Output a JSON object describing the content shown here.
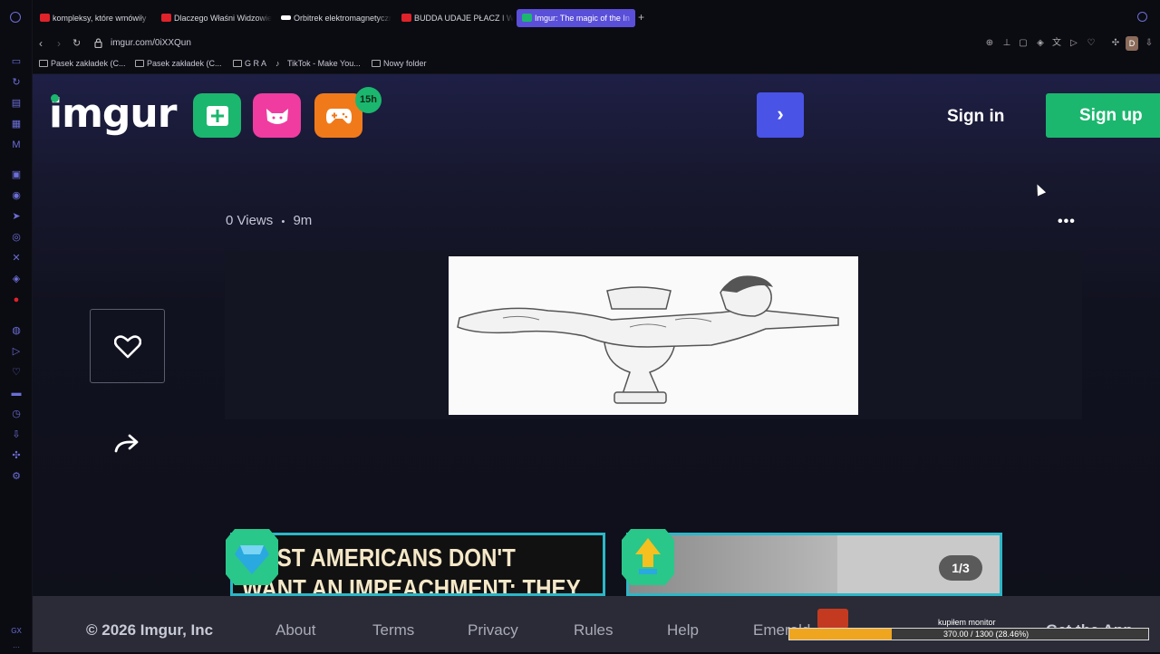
{
  "browser": {
    "tabs": [
      {
        "title": "kompleksy, które wmówiły",
        "favicon_color": "#e0222a"
      },
      {
        "title": "Dlaczego Właśni Widzowie",
        "favicon_color": "#e0222a"
      },
      {
        "title": "Orbitrek elektromagnetyczny",
        "favicon_color": "#ffffff"
      },
      {
        "title": "BUDDA UDAJE PŁACZ I W",
        "favicon_color": "#e0222a"
      },
      {
        "title": "Imgur: The magic of the In",
        "favicon_color": "#1bb76e",
        "active": true
      }
    ],
    "url": "imgur.com/0iXXQun",
    "profile_initial": "D",
    "bookmarks": [
      {
        "label": "Pasek zakładek (C..."
      },
      {
        "label": "Pasek zakładek (C..."
      },
      {
        "label": "G R A"
      },
      {
        "label": "TikTok - Make You..."
      },
      {
        "label": "Nowy folder"
      }
    ]
  },
  "imgur": {
    "logo": "imgur",
    "badge": "15h",
    "sign_in": "Sign in",
    "sign_up": "Sign up",
    "meta": {
      "views": "0 Views",
      "separator": "•",
      "age": "9m"
    },
    "card1_text_line1": "MOST AMERICANS DON'T",
    "card1_text_line2": "WANT AN IMPEACHMENT: THEY",
    "card2_counter": "1/3",
    "footer": {
      "copyright": "© 2026 Imgur, Inc",
      "about": "About",
      "terms": "Terms",
      "privacy": "Privacy",
      "rules": "Rules",
      "help": "Help",
      "emerald": "Emerald",
      "get_app": "Get the App"
    }
  },
  "stream_widget": {
    "label": "kupiłem monitor",
    "progress_text": "370.00 / 1300 (28.46%)",
    "progress_fraction": 0.2846
  },
  "colors": {
    "imgur_green": "#1bb76e",
    "imgur_pink": "#f03ca0",
    "imgur_orange": "#f07a1a",
    "accent_blue": "#4953e6",
    "active_tab": "#5a4fd8"
  }
}
